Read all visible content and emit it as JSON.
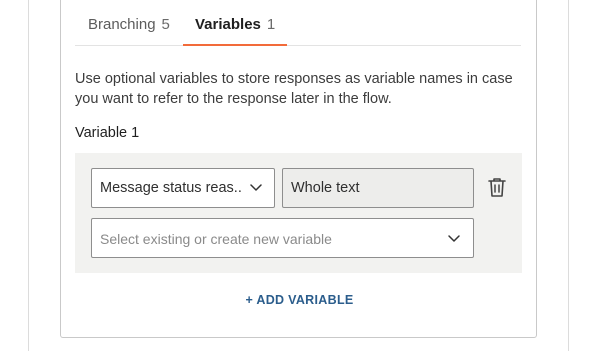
{
  "tabs": [
    {
      "label": "Branching",
      "count": "5",
      "active": false
    },
    {
      "label": "Variables",
      "count": "1",
      "active": true
    }
  ],
  "description": "Use optional variables to store responses as variable names in case you want to refer to the response later in the flow.",
  "variable": {
    "title": "Variable 1",
    "source_select": {
      "value": "Message status reas.."
    },
    "extract_field": {
      "value": "Whole text"
    },
    "variable_select": {
      "placeholder": "Select existing or create new variable"
    }
  },
  "actions": {
    "add_variable_label": "+ ADD VARIABLE"
  },
  "colors": {
    "accent_tab": "#f26b3a",
    "link": "#2b5d8c",
    "panel_bg": "#f2f2f0"
  },
  "icons": {
    "delete": "trash-icon",
    "dropdown": "chevron-down-icon"
  }
}
